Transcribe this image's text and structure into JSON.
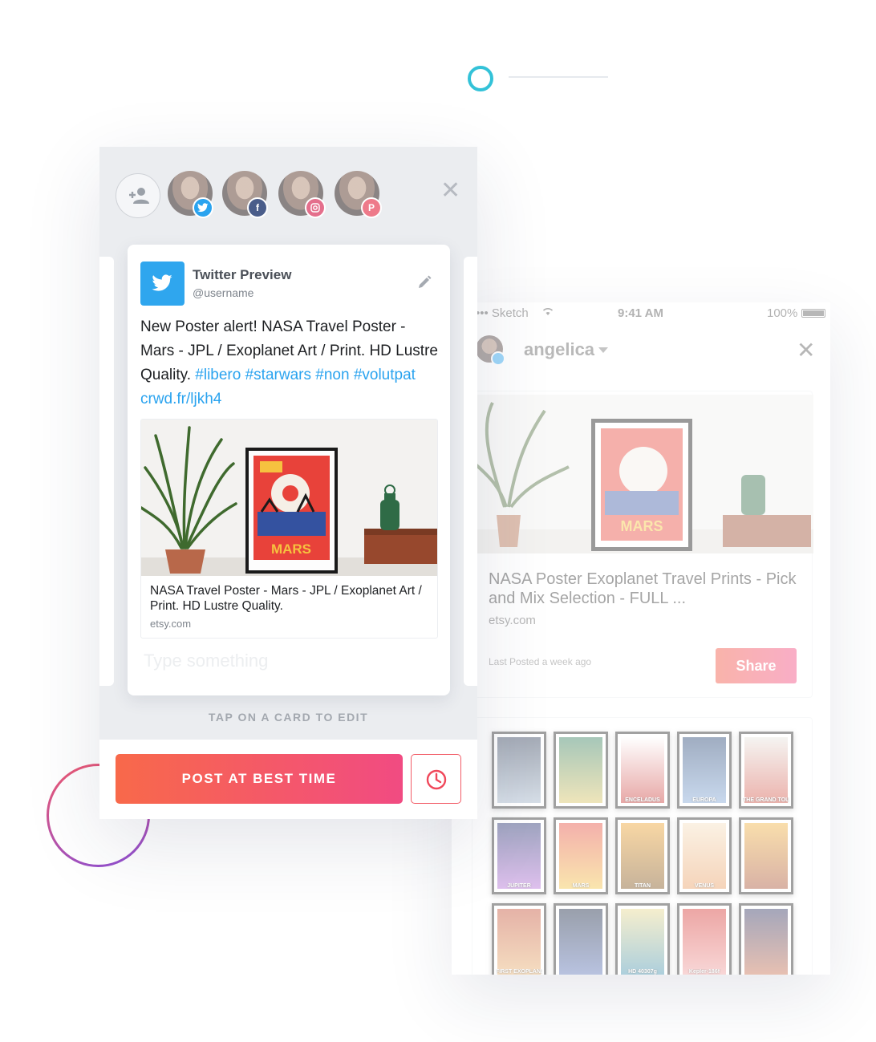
{
  "colors": {
    "accent_gradient_start": "#f8694a",
    "accent_gradient_end": "#f14b82",
    "twitter_blue": "#2aa3ef",
    "facebook_blue": "#3b5998",
    "instagram_pink": "#e1306c",
    "pinterest_red": "#e60023",
    "ring_top": "#33c2d8"
  },
  "composer": {
    "accounts": [
      {
        "network": "twitter",
        "icon": "twitter-icon"
      },
      {
        "network": "facebook",
        "icon": "facebook-icon"
      },
      {
        "network": "instagram",
        "icon": "instagram-icon"
      },
      {
        "network": "pinterest",
        "icon": "pinterest-icon"
      }
    ],
    "add_account_icon": "add-user-icon",
    "close_icon": "close-icon",
    "preview": {
      "title": "Twitter Preview",
      "handle": "@username",
      "text_plain": "New Poster alert! NASA Travel Poster - Mars - JPL / Exoplanet Art  / Print. HD Lustre Quality. ",
      "hashtags": [
        "#libero",
        "#starwars",
        "#non",
        "#volutpat"
      ],
      "short_link": "crwd.fr/ljkh4",
      "link_title": "NASA Travel Poster - Mars - JPL / Exoplanet Art  / Print. HD Lustre Quality.",
      "link_domain": "etsy.com",
      "input_placeholder": "Type something"
    },
    "hint": "TAP ON A CARD TO EDIT",
    "post_button": "POST AT BEST TIME",
    "schedule_icon": "clock-icon"
  },
  "phone": {
    "status": {
      "carrier": "••• Sketch",
      "time": "9:41 AM",
      "battery": "100%"
    },
    "profile_name": "angelica",
    "card": {
      "title": "NASA Poster Exoplanet Travel Prints - Pick and Mix Selection - FULL ...",
      "domain": "etsy.com",
      "meta": "Last Posted a week ago",
      "share_button": "Share"
    },
    "posters": [
      {
        "label": "",
        "top": "#2b3a55",
        "bottom": "#9fb2c8"
      },
      {
        "label": "",
        "top": "#2e7b5a",
        "bottom": "#d9c25c"
      },
      {
        "label": "ENCELADUS",
        "top": "#ffffff",
        "bottom": "#c8312e"
      },
      {
        "label": "EUROPA",
        "top": "#1f3e6e",
        "bottom": "#7fa5d6"
      },
      {
        "label": "THE GRAND TOUR",
        "top": "#e8e6e0",
        "bottom": "#d24a3c"
      },
      {
        "label": "JUPITER",
        "top": "#1d2a6b",
        "bottom": "#b26ad6"
      },
      {
        "label": "MARS",
        "top": "#e5463a",
        "bottom": "#f3c33f"
      },
      {
        "label": "TITAN",
        "top": "#f0a128",
        "bottom": "#7a4b12"
      },
      {
        "label": "VENUS",
        "top": "#f6e0c0",
        "bottom": "#e99a5c"
      },
      {
        "label": "",
        "top": "#f2b23b",
        "bottom": "#a5492c"
      },
      {
        "label": "FIRST EXOPLANET",
        "top": "#c24a2f",
        "bottom": "#e8b06b"
      },
      {
        "label": "",
        "top": "#0f1d3a",
        "bottom": "#5870b5"
      },
      {
        "label": "HD 40307g",
        "top": "#e9d88a",
        "bottom": "#3e8fae"
      },
      {
        "label": "Kepler-186f",
        "top": "#d42e2a",
        "bottom": "#f0a0a0"
      },
      {
        "label": "",
        "top": "#2a2f5e",
        "bottom": "#c76b4a"
      }
    ]
  }
}
